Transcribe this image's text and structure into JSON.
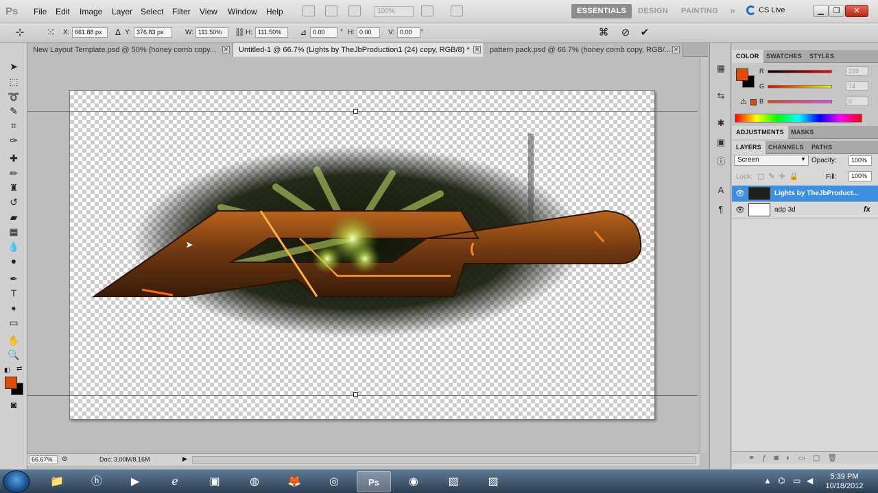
{
  "app": {
    "logo": "Ps"
  },
  "menu": [
    "File",
    "Edit",
    "Image",
    "Layer",
    "Select",
    "Filter",
    "View",
    "Window",
    "Help"
  ],
  "menubar": {
    "zoom": "100%",
    "workspaces": [
      "ESSENTIALS",
      "DESIGN",
      "PAINTING"
    ],
    "more": "»",
    "cs_live": "CS Live"
  },
  "options": {
    "x_label": "X:",
    "x_value": "661.88 px",
    "y_label": "Y:",
    "y_value": "376.83 px",
    "w_label": "W:",
    "w_value": "111.50%",
    "h_label": "H:",
    "h_value": "111.50%",
    "angle_value": "0.00",
    "hskew_label": "H:",
    "hskew_value": "0.00",
    "vskew_label": "V:",
    "vskew_value": "0.00",
    "degree": "°"
  },
  "tabs": [
    {
      "label": "New Layout Template.psd @ 50% (honey comb copy..."
    },
    {
      "label": "Untitled-1 @ 66.7% (Lights by TheJbProduction1 (24) copy, RGB/8) *"
    },
    {
      "label": "pattern pack.psd @ 66.7% (honey comb copy, RGB/..."
    }
  ],
  "status": {
    "zoom": "66.67%",
    "doc": "Doc: 3.00M/8.16M"
  },
  "color_panel": {
    "tabs": [
      "COLOR",
      "SWATCHES",
      "STYLES"
    ],
    "r_label": "R",
    "r_value": "228",
    "g_label": "G",
    "g_value": "74",
    "b_label": "B",
    "b_value": "0",
    "foreground": "#e44a00"
  },
  "adjust_tabs": [
    "ADJUSTMENTS",
    "MASKS"
  ],
  "layers_panel": {
    "tabs": [
      "LAYERS",
      "CHANNELS",
      "PATHS"
    ],
    "blend_mode": "Screen",
    "opacity_label": "Opacity:",
    "opacity": "100%",
    "lock_label": "Lock:",
    "fill_label": "Fill:",
    "fill": "100%",
    "layers": [
      {
        "name": "Lights by TheJbProduct...",
        "selected": true,
        "fx": ""
      },
      {
        "name": "adp 3d",
        "selected": false,
        "fx": "fx"
      }
    ]
  },
  "taskbar": {
    "time": "5:39 PM",
    "date": "10/18/2012"
  }
}
